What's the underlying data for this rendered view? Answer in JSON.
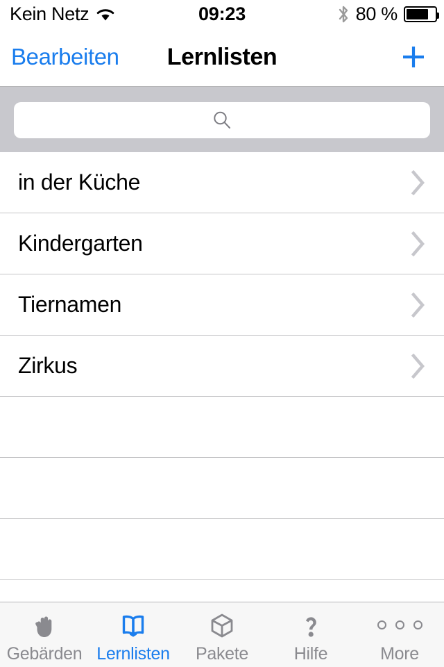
{
  "status_bar": {
    "carrier": "Kein Netz",
    "wifi_icon": "wifi-icon",
    "time": "09:23",
    "bluetooth_icon": "bluetooth-icon",
    "battery_text": "80 %",
    "battery_percent": 80
  },
  "nav_bar": {
    "edit_label": "Bearbeiten",
    "title": "Lernlisten",
    "add_icon": "plus-icon"
  },
  "search": {
    "value": "",
    "placeholder": "",
    "icon": "search-icon"
  },
  "list": {
    "items": [
      {
        "label": "in der Küche",
        "chevron": "chevron-right-icon"
      },
      {
        "label": "Kindergarten",
        "chevron": "chevron-right-icon"
      },
      {
        "label": "Tiernamen",
        "chevron": "chevron-right-icon"
      },
      {
        "label": "Zirkus",
        "chevron": "chevron-right-icon"
      }
    ],
    "empty_rows": 3
  },
  "tab_bar": {
    "active_index": 1,
    "tabs": [
      {
        "label": "Gebärden",
        "icon": "hand-icon"
      },
      {
        "label": "Lernlisten",
        "icon": "book-icon"
      },
      {
        "label": "Pakete",
        "icon": "cube-icon"
      },
      {
        "label": "Hilfe",
        "icon": "question-mark-icon"
      },
      {
        "label": "More",
        "icon": "ellipsis-icon"
      }
    ]
  },
  "colors": {
    "accent": "#1a7ded",
    "inactive": "#8a8a8f",
    "search_bg": "#c8c8cd",
    "separator": "#c4c4c6",
    "tabbar_bg": "#f7f7f7"
  }
}
